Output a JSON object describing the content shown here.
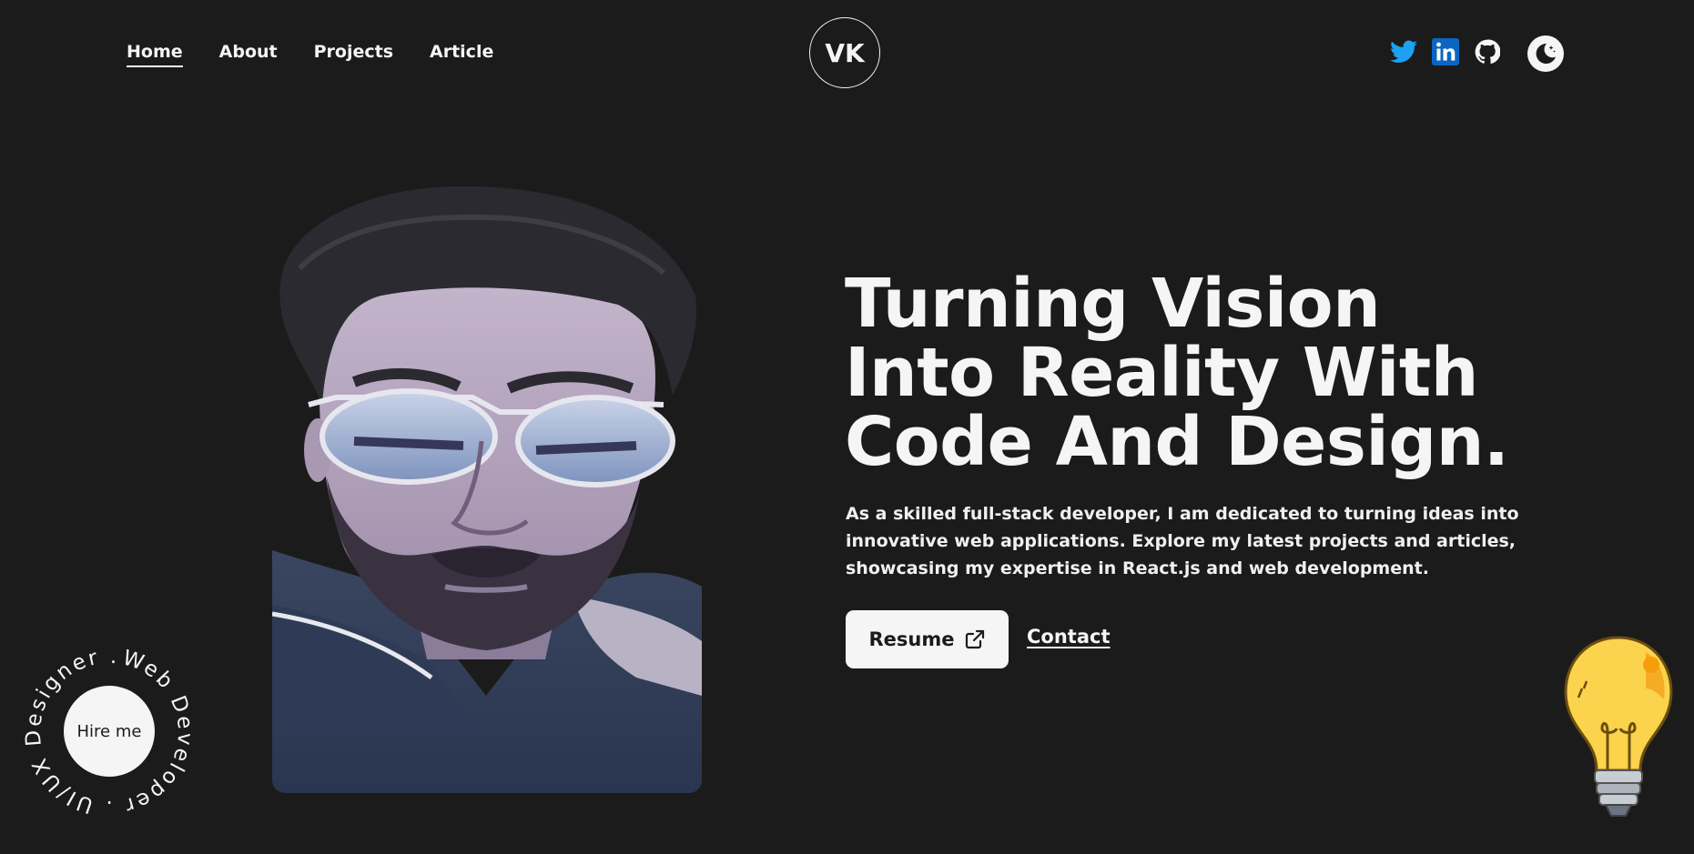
{
  "nav": {
    "links": [
      {
        "label": "Home",
        "active": true
      },
      {
        "label": "About"
      },
      {
        "label": "Projects"
      },
      {
        "label": "Article"
      }
    ]
  },
  "logo": {
    "initials": "VK"
  },
  "socials": [
    "twitter-icon",
    "linkedin-icon",
    "github-icon"
  ],
  "theme_toggle": {
    "icon": "moon-icon"
  },
  "hero": {
    "headline": "Turning Vision Into Reality With Code And Design.",
    "intro": "As a skilled full-stack developer, I am dedicated to turning ideas into innovative web applications. Explore my latest projects and articles, showcasing my expertise in React.js and web development.",
    "resume_label": "Resume",
    "contact_label": "Contact"
  },
  "hire": {
    "button_label": "Hire me",
    "ring_text": "Web Developer . UI/UX Designer . "
  },
  "colors": {
    "background": "#1b1b1b",
    "foreground": "#f5f5f5",
    "twitter": "#1da1f2",
    "linkedin": "#0a66c2",
    "bulb": "#fcd34d"
  }
}
